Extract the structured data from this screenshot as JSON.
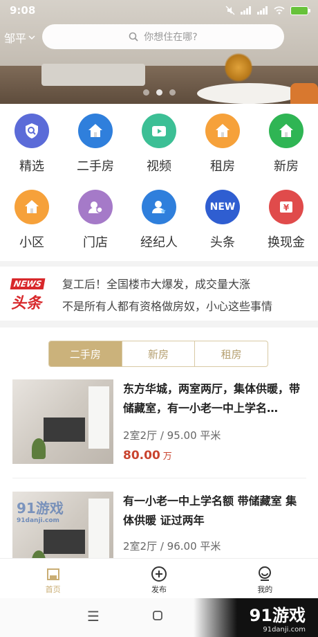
{
  "status_bar": {
    "time": "9:08"
  },
  "header": {
    "city": "邹平",
    "search_placeholder": "你想住在哪?"
  },
  "banner": {
    "slide_count": 3,
    "active_slide": 2
  },
  "categories": [
    {
      "label": "精选",
      "icon": "shield-search-icon",
      "color": "#5b6bd8"
    },
    {
      "label": "二手房",
      "icon": "house-icon",
      "color": "#2f7fdc"
    },
    {
      "label": "视频",
      "icon": "video-icon",
      "color": "#3cbf95"
    },
    {
      "label": "租房",
      "icon": "house-icon",
      "color": "#f6a13a"
    },
    {
      "label": "新房",
      "icon": "house-icon",
      "color": "#2fb554"
    },
    {
      "label": "小区",
      "icon": "house-icon",
      "color": "#f6a13a"
    },
    {
      "label": "门店",
      "icon": "store-icon",
      "color": "#a57ac8"
    },
    {
      "label": "经纪人",
      "icon": "agent-icon",
      "color": "#2f7fdc"
    },
    {
      "label": "头条",
      "icon": "new-badge-icon",
      "color": "#2f5ed1",
      "badge_text": "NEW"
    },
    {
      "label": "换现金",
      "icon": "cash-icon",
      "color": "#e04b4b"
    }
  ],
  "news": {
    "logo_tag": "NEWS",
    "logo_head": "头条",
    "headlines": [
      "复工后！全国楼市大爆发，成交量大涨",
      "不是所有人都有资格做房奴，小心这些事情"
    ]
  },
  "tabs": [
    {
      "label": "二手房",
      "active": true
    },
    {
      "label": "新房",
      "active": false
    },
    {
      "label": "租房",
      "active": false
    }
  ],
  "listings": [
    {
      "title": "东方华城，两室两厅，集体供暖，带储藏室，有一小老一中上学名…",
      "meta": "2室2厅 / 95.00 平米",
      "price": "80.00",
      "price_unit": "万"
    },
    {
      "title": "有一小老一中上学名额 带储藏室 集体供暖 证过两年",
      "meta": "2室2厅 / 96.00 平米",
      "watermark": "91游戏",
      "watermark_url": "91danji.com"
    }
  ],
  "bottom_nav": [
    {
      "label": "首页",
      "icon": "home-icon",
      "active": true
    },
    {
      "label": "发布",
      "icon": "plus-circle-icon",
      "active": false
    },
    {
      "label": "我的",
      "icon": "profile-icon",
      "active": false
    }
  ],
  "watermark": {
    "logo": "91游戏",
    "url": "91danji.com"
  }
}
